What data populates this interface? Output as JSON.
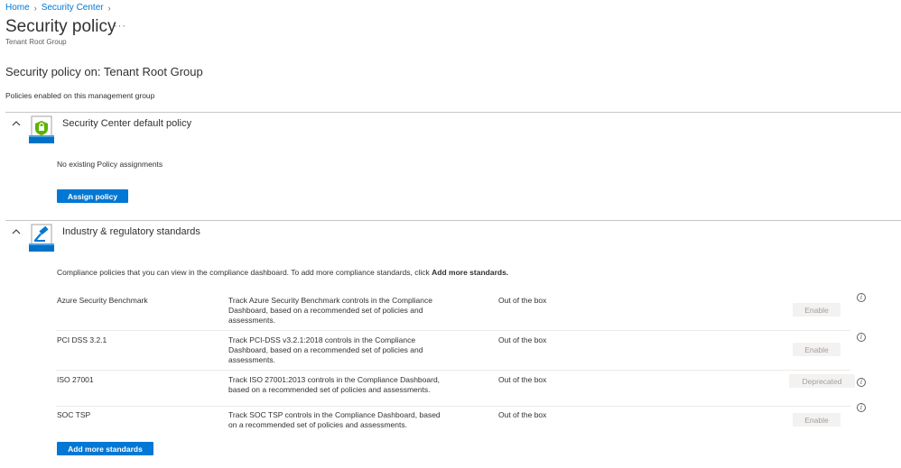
{
  "breadcrumb": [
    {
      "label": "Home"
    },
    {
      "label": "Security Center"
    }
  ],
  "page": {
    "title": "Security policy",
    "more_label": "···",
    "subtitle": "Tenant Root Group",
    "section_heading": "Security policy on: Tenant Root Group",
    "section_desc": "Policies enabled on this management group"
  },
  "default_policy": {
    "title": "Security Center default policy",
    "empty_text": "No existing Policy assignments",
    "assign_label": "Assign policy"
  },
  "standards": {
    "title": "Industry & regulatory standards",
    "intro": "Compliance policies that you can view in the compliance dashboard. To add more compliance standards, click ",
    "intro_bold": "Add more standards.",
    "add_label": "Add more standards",
    "rows": [
      {
        "name": "Azure Security Benchmark",
        "desc": "Track Azure Security Benchmark controls in the Compliance Dashboard, based on a recommended set of policies and assessments.",
        "source": "Out of the box",
        "action": "Enable"
      },
      {
        "name": "PCI DSS 3.2.1",
        "desc": "Track PCI-DSS v3.2.1:2018 controls in the Compliance Dashboard, based on a recommended set of policies and assessments.",
        "source": "Out of the box",
        "action": "Enable"
      },
      {
        "name": "ISO 27001",
        "desc": "Track ISO 27001:2013 controls in the Compliance Dashboard, based on a recommended set of policies and assessments.",
        "source": "Out of the box",
        "action": "Deprecated"
      },
      {
        "name": "SOC TSP",
        "desc": "Track SOC TSP controls in the Compliance Dashboard, based on a recommended set of policies and assessments.",
        "source": "Out of the box",
        "action": "Enable"
      }
    ]
  },
  "icons": {
    "collapse": "chevron-up-icon",
    "info": "info-icon",
    "default_policy": "shield-lock-icon",
    "standards": "gavel-icon"
  },
  "colors": {
    "accent": "#0078d4",
    "text": "#323130",
    "disabled_bg": "#f3f2f1",
    "disabled_text": "#a19f9d"
  }
}
